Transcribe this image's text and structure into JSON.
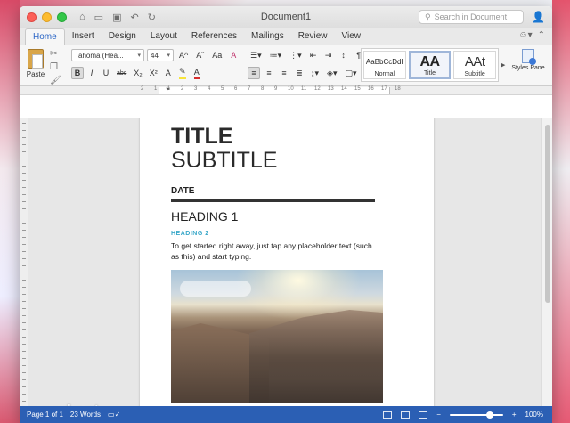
{
  "window": {
    "title": "Document1"
  },
  "search": {
    "placeholder": "Search in Document"
  },
  "tabs": [
    "Home",
    "Insert",
    "Design",
    "Layout",
    "References",
    "Mailings",
    "Review",
    "View"
  ],
  "ribbon": {
    "paste_label": "Paste",
    "font_name": "Tahoma (Hea...",
    "font_size": "44",
    "grow_font": "A^",
    "shrink_font": "Aˇ",
    "change_case": "Aa",
    "clear_format": "A",
    "bold": "B",
    "italic": "I",
    "underline": "U",
    "strikethrough": "abc",
    "subscript": "X₂",
    "superscript": "X²",
    "styles": [
      {
        "sample": "AaBbCcDdI",
        "label": "Normal"
      },
      {
        "sample": "AA",
        "label": "Title"
      },
      {
        "sample": "AAt",
        "label": "Subtitle"
      }
    ],
    "styles_pane_label": "Styles Pane"
  },
  "ruler": {
    "numbers": [
      "2",
      "1",
      "1",
      "2",
      "3",
      "4",
      "5",
      "6",
      "7",
      "8",
      "9",
      "10",
      "11",
      "12",
      "13",
      "14",
      "15",
      "16",
      "17",
      "18"
    ]
  },
  "document": {
    "title": "TITLE",
    "subtitle": "SUBTITLE",
    "date": "DATE",
    "heading1": "HEADING 1",
    "heading2": "HEADING 2",
    "body": "To get started right away, just tap any placeholder text (such as this) and start typing."
  },
  "watermark": "engadget",
  "status": {
    "page": "Page 1 of 1",
    "words": "23 Words",
    "zoom": "100%",
    "zoom_fraction": 0.75
  },
  "colors": {
    "accent_tab": "#2b66c6",
    "statusbar": "#2b5fb4",
    "heading2": "#3aa8c9"
  }
}
